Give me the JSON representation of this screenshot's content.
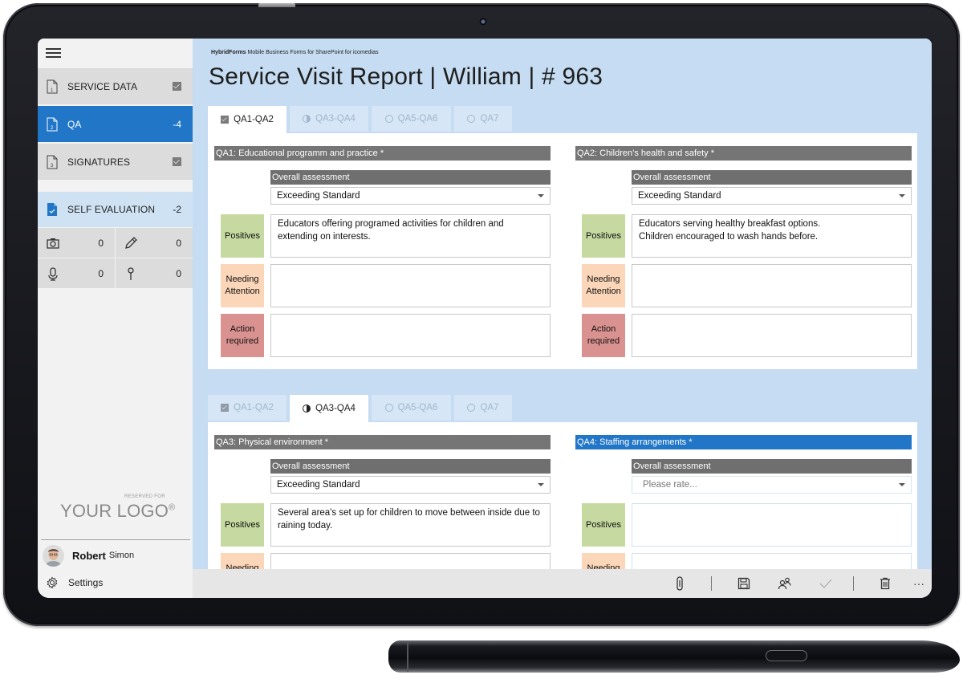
{
  "app": {
    "brand_bold": "HybridForms",
    "brand_rest": " Mobile Business Forms for SharePoint for icomedias",
    "title": "Service Visit Report | William | # 963"
  },
  "sidebar": {
    "menu_icon": "hamburger-icon",
    "items": [
      {
        "label": "SERVICE DATA",
        "number": "1",
        "status": "checked",
        "icon": "document-1-icon"
      },
      {
        "label": "QA",
        "number": "2",
        "badge": "-4",
        "icon": "document-2-icon",
        "active": true
      },
      {
        "label": "SIGNATURES",
        "number": "3",
        "status": "checked",
        "icon": "document-3-icon"
      },
      {
        "label": "SELF EVALUATION",
        "badge": "-2",
        "icon": "document-check-icon"
      }
    ],
    "stats": [
      {
        "icon": "camera-icon",
        "count": "0"
      },
      {
        "icon": "pencil-icon",
        "count": "0"
      },
      {
        "icon": "microphone-icon",
        "count": "0"
      },
      {
        "icon": "location-pin-icon",
        "count": "0"
      }
    ],
    "logo": {
      "small": "RESERVED FOR",
      "big": "YOUR LOGO",
      "reg": "®"
    },
    "user": {
      "first": "Robert",
      "last": "Simon"
    },
    "settings_label": "Settings"
  },
  "tabsets": [
    {
      "tabs": [
        {
          "label": "QA1-QA2",
          "state_icon": "checkbox-checked-icon",
          "active": true
        },
        {
          "label": "QA3-QA4",
          "state_icon": "half-circle-icon",
          "active": false
        },
        {
          "label": "QA5-QA6",
          "state_icon": "empty-circle-icon",
          "active": false
        },
        {
          "label": "QA7",
          "state_icon": "empty-circle-icon",
          "active": false
        }
      ],
      "sections": [
        {
          "title": "QA1: Educational programm and practice *",
          "overall_label": "Overall assessment",
          "assessment": "Exceeding Standard",
          "positives": "Educators offering programed activities for children and\nextending on interests.",
          "needing_attention": "",
          "action_required": ""
        },
        {
          "title": "QA2: Children’s health and safety *",
          "overall_label": "Overall assessment",
          "assessment": "Exceeding Standard",
          "positives": "Educators serving healthy breakfast options.\nChildren encouraged to wash hands before.",
          "needing_attention": "",
          "action_required": ""
        }
      ]
    },
    {
      "tabs": [
        {
          "label": "QA1-QA2",
          "state_icon": "checkbox-checked-icon",
          "active": false
        },
        {
          "label": "QA3-QA4",
          "state_icon": "half-circle-icon",
          "active": true
        },
        {
          "label": "QA5-QA6",
          "state_icon": "empty-circle-icon",
          "active": false
        },
        {
          "label": "QA7",
          "state_icon": "empty-circle-icon",
          "active": false
        }
      ],
      "sections": [
        {
          "title": "QA3: Physical environment *",
          "overall_label": "Overall assessment",
          "assessment": "Exceeding Standard",
          "positives": "Several area's set up for children to move between inside due to\nraining today.",
          "needing_attention": ""
        },
        {
          "title": "QA4: Staffing arrangements *",
          "overall_label": "Overall assessment",
          "assessment_placeholder": "Please rate...",
          "positives": "",
          "needing_attention": ""
        }
      ]
    }
  ],
  "row_labels": {
    "positives": "Positives",
    "needing_attention": "Needing\nAttention",
    "action_required": "Action\nrequired"
  },
  "commandbar": [
    {
      "name": "attach-button",
      "icon": "paperclip-icon"
    },
    {
      "name": "save-button",
      "icon": "floppy-disk-icon"
    },
    {
      "name": "share-users-button",
      "icon": "people-icon"
    },
    {
      "name": "submit-button",
      "icon": "checkmark-icon",
      "disabled": true
    },
    {
      "name": "delete-button",
      "icon": "trash-icon"
    },
    {
      "name": "more-button",
      "icon": "ellipsis-icon",
      "label": "···"
    }
  ],
  "colors": {
    "accent": "#2176c7",
    "main_bg": "#c5dcf2",
    "section_header": "#757575",
    "positives": "#c6d9a0",
    "needing_attention": "#fbd6b8",
    "action_required": "#d9928f"
  }
}
